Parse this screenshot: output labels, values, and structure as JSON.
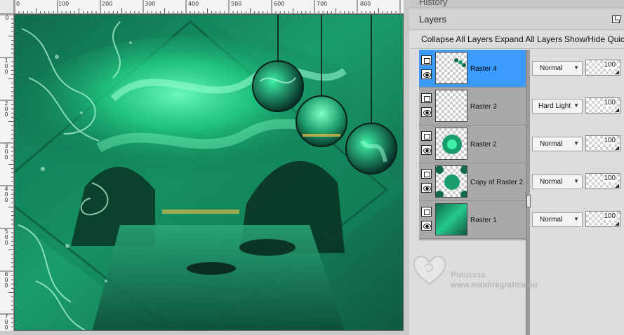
{
  "canvas": {
    "ruler_h_labels": [
      "0",
      "100",
      "200",
      "300",
      "400",
      "500",
      "600",
      "700",
      "800"
    ],
    "ruler_v_labels": [
      "0",
      "100",
      "200",
      "300",
      "400",
      "500",
      "600",
      "700"
    ]
  },
  "history": {
    "title": "History"
  },
  "layers_palette": {
    "title": "Layers",
    "toolbar": {
      "collapse_all": "Collapse All Layers",
      "expand_all": "Expand All Layers",
      "show_hide": "Show/Hide Quick"
    },
    "layers": [
      {
        "name": "Raster 4",
        "blend_mode": "Normal",
        "opacity": "100",
        "selected": true,
        "thumb": "ornaments"
      },
      {
        "name": "Raster 3",
        "blend_mode": "Hard Light",
        "opacity": "100",
        "selected": false,
        "thumb": "empty"
      },
      {
        "name": "Raster 2",
        "blend_mode": "Normal",
        "opacity": "100",
        "selected": false,
        "thumb": "flower"
      },
      {
        "name": "Copy of Raster 2",
        "blend_mode": "Normal",
        "opacity": "100",
        "selected": false,
        "thumb": "flower-edges"
      },
      {
        "name": "Raster 1",
        "blend_mode": "Normal",
        "opacity": "100",
        "selected": false,
        "thumb": "green-texture"
      }
    ]
  },
  "watermark": {
    "name": "Pinuccia",
    "site": "www.maidiregrafica.eu"
  },
  "colors": {
    "selected_row": "#3c9bff",
    "layers_tree_bg": "#a9a9a9",
    "aurora_green": "#2fe39a",
    "canvas_dark": "#0d4a35"
  }
}
